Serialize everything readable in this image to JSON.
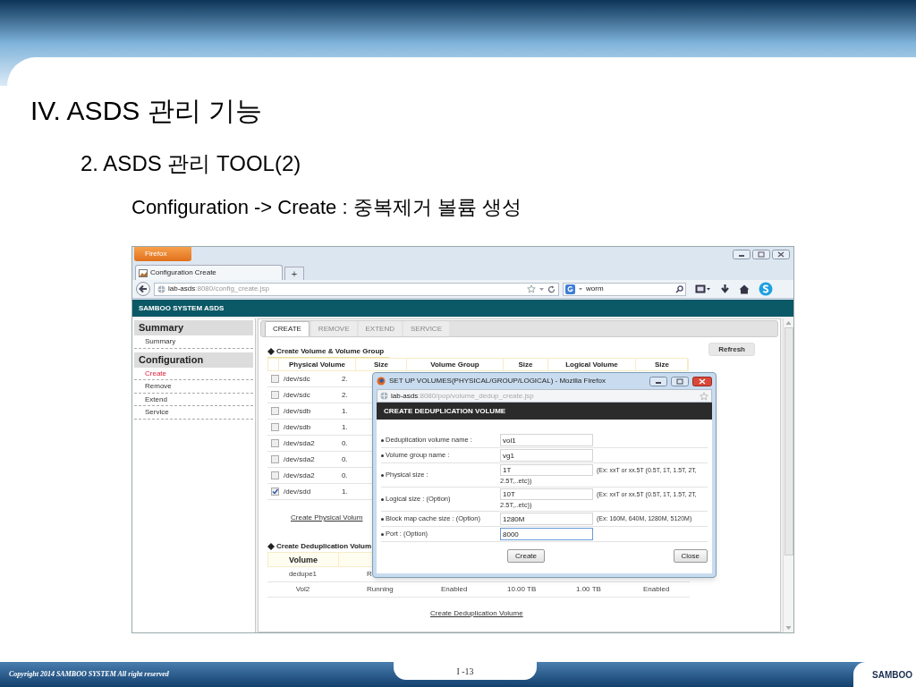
{
  "slide": {
    "title": "IV. ASDS 관리 기능",
    "subtitle": "2. ASDS 관리 TOOL(2)",
    "heading": "Configuration -> Create : 중복제거 볼륨 생성",
    "copyright": "Copyright 2014 SAMBOO SYSTEM All right reserved",
    "page": "I -13",
    "logo": "SAMBOO"
  },
  "browser": {
    "menu_button": "Firefox",
    "tab": "Configuration Create",
    "new_tab": "+",
    "url_host": "lab-asds",
    "url_path": ":8080/config_create.jsp",
    "search_value": "worm"
  },
  "app": {
    "header": "SAMBOO SYSTEM ASDS"
  },
  "sidebar": {
    "sections": [
      {
        "title": "Summary",
        "items": [
          {
            "label": "Summary",
            "selected": false
          }
        ]
      },
      {
        "title": "Configuration",
        "items": [
          {
            "label": "Create",
            "selected": true
          },
          {
            "label": "Remove",
            "selected": false
          },
          {
            "label": "Extend",
            "selected": false
          },
          {
            "label": "Service",
            "selected": false
          }
        ]
      }
    ]
  },
  "tabs": [
    {
      "label": "CREATE",
      "selected": true
    },
    {
      "label": "REMOVE",
      "selected": false
    },
    {
      "label": "EXTEND",
      "selected": false
    },
    {
      "label": "SERVICE",
      "selected": false
    }
  ],
  "refresh_button": "Refresh",
  "volume_section": {
    "title": "Create Volume & Volume Group",
    "columns": [
      "Physical Volume",
      "Size",
      "Volume Group",
      "Size",
      "Logical Volume",
      "Size"
    ],
    "rows": [
      {
        "checked": false,
        "name": "/dev/sdc",
        "size": "2."
      },
      {
        "checked": false,
        "name": "/dev/sdc",
        "size": "2."
      },
      {
        "checked": false,
        "name": "/dev/sdb",
        "size": "1."
      },
      {
        "checked": false,
        "name": "/dev/sdb",
        "size": "1."
      },
      {
        "checked": false,
        "name": "/dev/sda2",
        "size": "0."
      },
      {
        "checked": false,
        "name": "/dev/sda2",
        "size": "0."
      },
      {
        "checked": false,
        "name": "/dev/sda2",
        "size": "0."
      },
      {
        "checked": true,
        "name": "/dev/sdd",
        "size": "1."
      }
    ],
    "link": "Create Physical Volum"
  },
  "dedup_section": {
    "title": "Create Deduplication Volum",
    "columns": [
      "Volume"
    ],
    "rows": [
      [
        "dedupe1",
        "R"
      ],
      [
        "Vol2",
        "Running",
        "Enabled",
        "10.00 TB",
        "1.00 TB",
        "Enabled"
      ]
    ],
    "link": "Create Deduplication Volume"
  },
  "dialog": {
    "title": "SET UP VOLUMES(PHYSICAL/GROUP/LOGICAL) - Mozilla Firefox",
    "url_host": "lab-asds",
    "url_path": ":8080/pop/volume_dedup_create.jsp",
    "header": "CREATE DEDUPLICATION VOLUME",
    "fields": [
      {
        "label": "Deduplication volume name :",
        "value": "vol1",
        "focused": false
      },
      {
        "label": "Volume group name :",
        "value": "vg1",
        "focused": false
      },
      {
        "label": "Physical size :",
        "value": "1T",
        "hint": "(Ex: xxT or xx.5T (0.5T, 1T, 1.5T, 2T,",
        "note": "2.5T,..etc))",
        "focused": false
      },
      {
        "label": "Logical size : (Option)",
        "value": "10T",
        "hint": "(Ex: xxT or xx.5T (0.5T, 1T, 1.5T, 2T,",
        "note": "2.5T,..etc))",
        "focused": false
      },
      {
        "label": "Block map cache size : (Option)",
        "value": "1280M",
        "hint": "(Ex: 160M, 640M, 1280M, 5120M)",
        "focused": false
      },
      {
        "label": "Port : (Option)",
        "value": "8000",
        "focused": true
      }
    ],
    "buttons": [
      "Create",
      "Close"
    ]
  }
}
